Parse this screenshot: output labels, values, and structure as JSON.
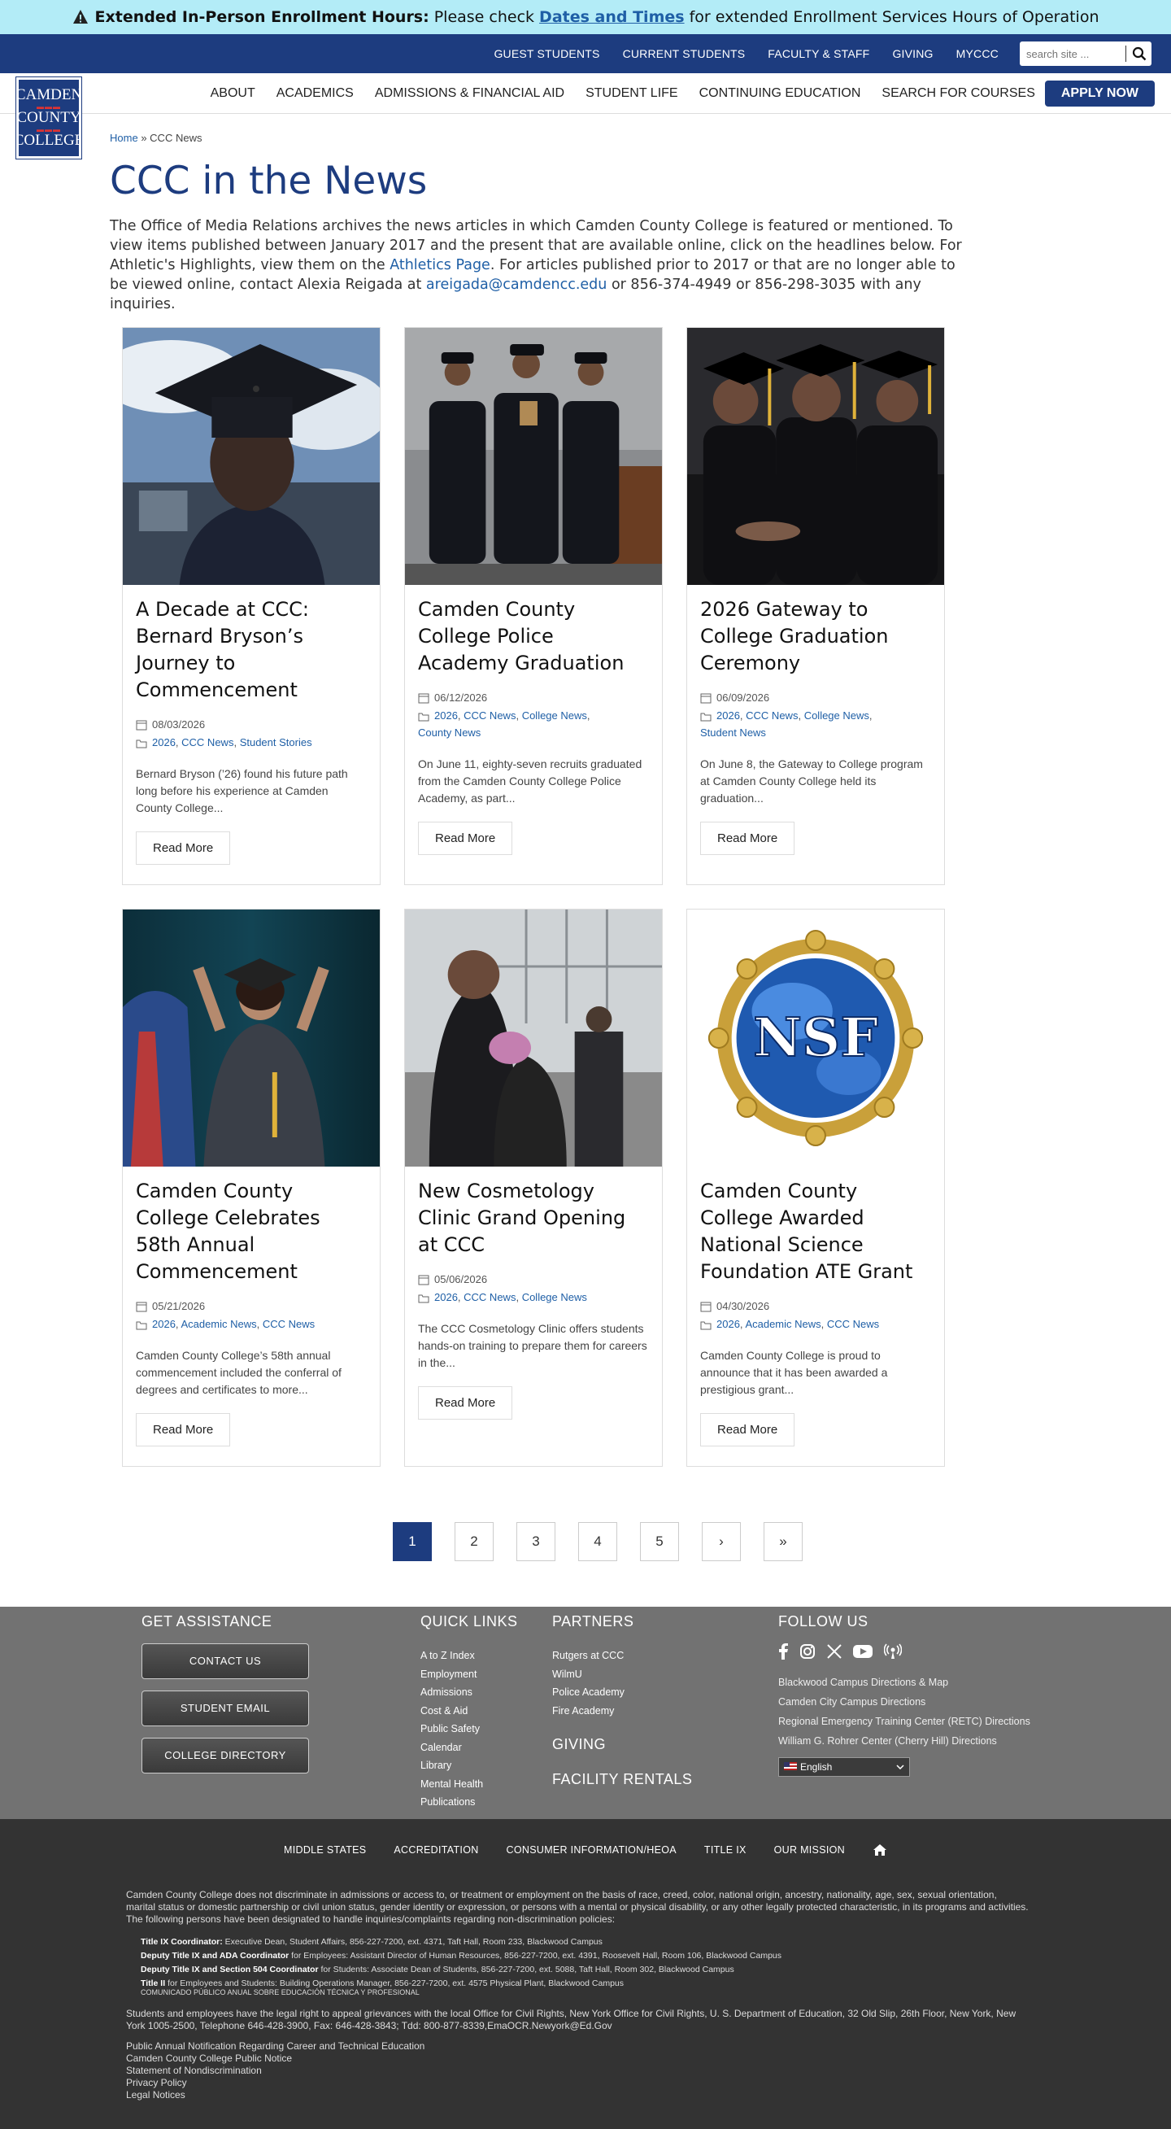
{
  "alert": {
    "bold": "Extended In-Person Enrollment Hours:",
    "pre": "Please check",
    "link": "Dates and Times",
    "post": "for extended Enrollment Services Hours of Operation"
  },
  "logo": {
    "line1": "CAMDEN",
    "line2": "COUNTY",
    "line3": "COLLEGE"
  },
  "top_nav": [
    "GUEST STUDENTS",
    "CURRENT STUDENTS",
    "FACULTY & STAFF",
    "GIVING",
    "MYCCC"
  ],
  "search": {
    "placeholder": "search site ..."
  },
  "main_nav": [
    "ABOUT",
    "ACADEMICS",
    "ADMISSIONS & FINANCIAL AID",
    "STUDENT LIFE",
    "CONTINUING EDUCATION",
    "SEARCH FOR COURSES"
  ],
  "apply": "APPLY NOW",
  "breadcrumb": {
    "home": "Home",
    "sep": "»",
    "current": "CCC News"
  },
  "title": "CCC in the News",
  "intro": {
    "p1": "The Office of Media Relations archives the news articles in which Camden County College is featured or mentioned. To view items published between January 2017 and the present that are available online, click on the headlines below. For Athletic's Highlights, view them on the",
    "link1": "Athletics Page",
    "p2": ". For articles published prior to 2017 or that are no longer able to be viewed online, contact Alexia Reigada at",
    "email": "areigada@camdencc.edu",
    "p3": "or 856-374-4949 or 856-298-3035 with any inquiries."
  },
  "cards": [
    {
      "title": "A Decade at CCC: Bernard Bryson’s Journey to Commencement",
      "date": "08/03/2026",
      "cats": [
        "2026",
        "CCC News",
        "Student Stories"
      ],
      "excerpt": "Bernard Bryson (’26) found his future path long before his experience at Camden County College...",
      "read": "Read More"
    },
    {
      "title": "Camden County College Police Academy Graduation",
      "date": "06/12/2026",
      "cats": [
        "2026",
        "CCC News",
        "College News",
        "County News"
      ],
      "excerpt": "On June 11, eighty-seven recruits graduated from the Camden County College Police Academy, as part...",
      "read": "Read More"
    },
    {
      "title": "2026 Gateway to College Graduation Ceremony",
      "date": "06/09/2026",
      "cats": [
        "2026",
        "CCC News",
        "College News",
        "Student News"
      ],
      "excerpt": "On June 8, the Gateway to College program at Camden County College held its graduation...",
      "read": "Read More"
    },
    {
      "title": "Camden County College Celebrates 58th Annual Commencement",
      "date": "05/21/2026",
      "cats": [
        "2026",
        "Academic News",
        "CCC News"
      ],
      "excerpt": "Camden County College’s 58th annual commencement included the conferral of degrees and certificates to more...",
      "read": "Read More"
    },
    {
      "title": "New Cosmetology Clinic Grand Opening at CCC",
      "date": "05/06/2026",
      "cats": [
        "2026",
        "CCC News",
        "College News"
      ],
      "excerpt": "The CCC Cosmetology Clinic offers students hands-on training to prepare them for careers in the...",
      "read": "Read More"
    },
    {
      "title": "Camden County College Awarded National Science Foundation ATE Grant",
      "date": "04/30/2026",
      "cats": [
        "2026",
        "Academic News",
        "CCC News"
      ],
      "excerpt": "Camden County College is proud to announce that it has been awarded a prestigious grant...",
      "read": "Read More",
      "logo_text": "NSF"
    }
  ],
  "pagination": [
    "1",
    "2",
    "3",
    "4",
    "5",
    "›",
    "»"
  ],
  "footer": {
    "assist_title": "GET ASSISTANCE",
    "assist_buttons": [
      "CONTACT US",
      "STUDENT EMAIL",
      "COLLEGE DIRECTORY"
    ],
    "quick_title": "QUICK LINKS",
    "quick_links": [
      "A to Z Index",
      "Employment",
      "Admissions",
      "Cost & Aid",
      "Public Safety",
      "Calendar",
      "Library",
      "Mental Health",
      "Publications"
    ],
    "partners_title": "PARTNERS",
    "partners": [
      "Rutgers at CCC",
      "WilmU",
      "Police Academy",
      "Fire Academy"
    ],
    "giving": "GIVING",
    "rentals": "FACILITY RENTALS",
    "follow_title": "FOLLOW US",
    "campus": [
      "Blackwood Campus Directions & Map",
      "Camden City Campus Directions",
      "Regional Emergency Training Center (RETC) Directions",
      "William G. Rohrer Center (Cherry Hill) Directions"
    ],
    "language": "English"
  },
  "bottom": {
    "links": [
      "MIDDLE STATES",
      "ACCREDITATION",
      "CONSUMER INFORMATION/HEOA",
      "TITLE IX",
      "OUR MISSION"
    ],
    "nondiscrimination": "Camden County College does not discriminate in admissions or access to, or treatment or employment on the basis of race, creed, color, national origin, ancestry, nationality, age, sex, sexual orientation, marital status or domestic partnership or civil union status, gender identity or expression, or persons with a mental or physical disability, or any other legally protected characteristic, in its programs and activities. The following persons have been designated to handle inquiries/complaints regarding non-discrimination policies:",
    "coordinators": [
      {
        "role": "Title IX Coordinator:",
        "text": "Executive Dean, Student Affairs, 856-227-7200, ext. 4371, Taft Hall, Room 233, Blackwood Campus"
      },
      {
        "role": "Deputy Title IX and ADA Coordinator",
        "text": "for Employees: Assistant Director of Human Resources, 856-227-7200, ext. 4391, Roosevelt Hall, Room 106, Blackwood Campus"
      },
      {
        "role": "Deputy Title IX and Section 504 Coordinator",
        "text": "for Students: Associate Dean of Students, 856-227-7200, ext. 5088, Taft Hall, Room 302, Blackwood Campus"
      },
      {
        "role": "Title II",
        "text": "for Employees and Students: Building Operations Manager, 856-227-7200, ext. 4575 Physical Plant, Blackwood Campus"
      }
    ],
    "spanish": "COMUNICADO PÚBLICO ANUAL SOBRE EDUCACIÓN TÉCNICA Y PROFESIONAL",
    "rights": "Students and employees have the legal right to appeal grievances with the local Office for Civil Rights, New York Office for Civil Rights, U. S. Department of Education, 32 Old Slip, 26th Floor, New York, New York 1005-2500, Telephone 646-428-3900, Fax: 646-428-3843; Tdd: 800-877-8339,EmaOCR.Newyork@Ed.Gov",
    "notices": [
      "Public Annual Notification Regarding Career and Technical Education",
      "Camden County College Public Notice",
      "Statement of Nondiscrimination",
      "Privacy Policy",
      "Legal Notices"
    ]
  }
}
